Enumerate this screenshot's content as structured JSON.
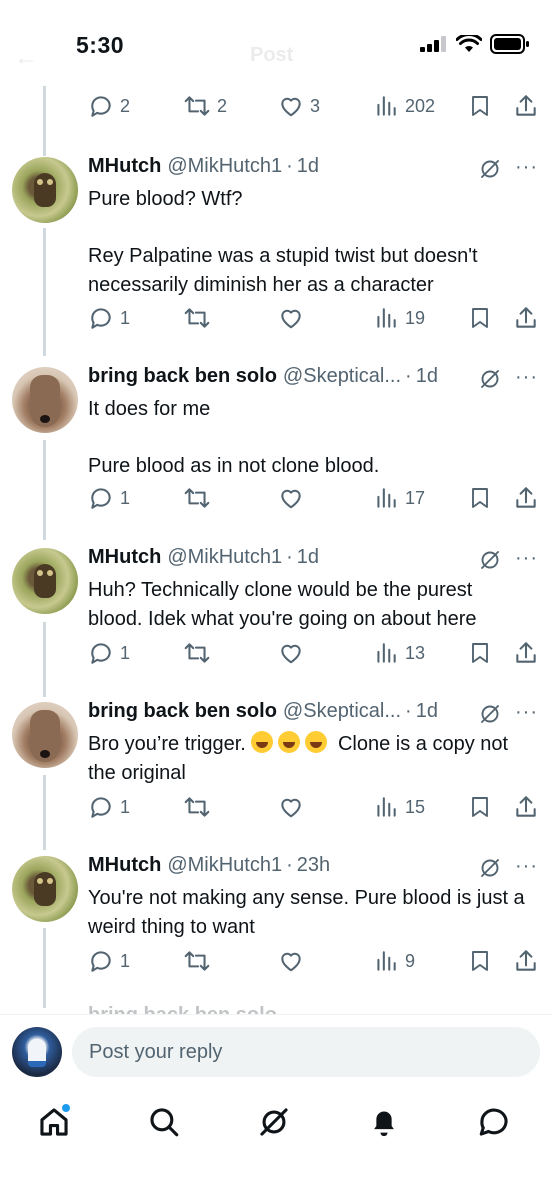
{
  "status_bar": {
    "time": "5:30"
  },
  "ghost_header": {
    "title": "Post"
  },
  "top_actions": {
    "replies": "2",
    "reposts": "2",
    "likes": "3",
    "views": "202"
  },
  "tweets": [
    {
      "name": "MHutch",
      "handle": "@MikHutch1",
      "dot": "·",
      "time": "1d",
      "text": "Pure blood? Wtf?\n\nRey Palpatine was a stupid twist but doesn't necessarily diminish her as a character",
      "replies": "1",
      "views": "19"
    },
    {
      "name": "bring back ben solo",
      "handle": "@Skeptical...",
      "dot": "·",
      "time": "1d",
      "text": "It does for me\n\nPure blood as in not clone blood.",
      "replies": "1",
      "views": "17"
    },
    {
      "name": "MHutch",
      "handle": "@MikHutch1",
      "dot": "·",
      "time": "1d",
      "text": "Huh? Technically clone would be the purest blood. Idek what you're going on about here",
      "replies": "1",
      "views": "13"
    },
    {
      "name": "bring back ben solo",
      "handle": "@Skeptical...",
      "dot": "·",
      "time": "1d",
      "text_before": "Bro you’re trigger.",
      "text_after": "Clone is a copy not the original",
      "replies": "1",
      "views": "15"
    },
    {
      "name": "MHutch",
      "handle": "@MikHutch1",
      "dot": "·",
      "time": "23h",
      "text": "You're not making any sense. Pure blood is just a weird thing to want",
      "replies": "1",
      "views": "9"
    }
  ],
  "partial_next": {
    "name": "bring back ben solo"
  },
  "reply_bar": {
    "placeholder": "Post your reply"
  },
  "more_glyph": "···",
  "colors": {
    "icon_gray": "#536471",
    "accent": "#1d9bf0",
    "text": "#0f1419",
    "thread_line": "#cfd9de"
  },
  "icons": [
    "reply-icon",
    "repost-icon",
    "like-icon",
    "views-icon",
    "bookmark-icon",
    "share-icon",
    "grok-icon",
    "more-icon",
    "home-icon",
    "search-icon",
    "grok-tab-icon",
    "notifications-icon",
    "messages-icon"
  ]
}
